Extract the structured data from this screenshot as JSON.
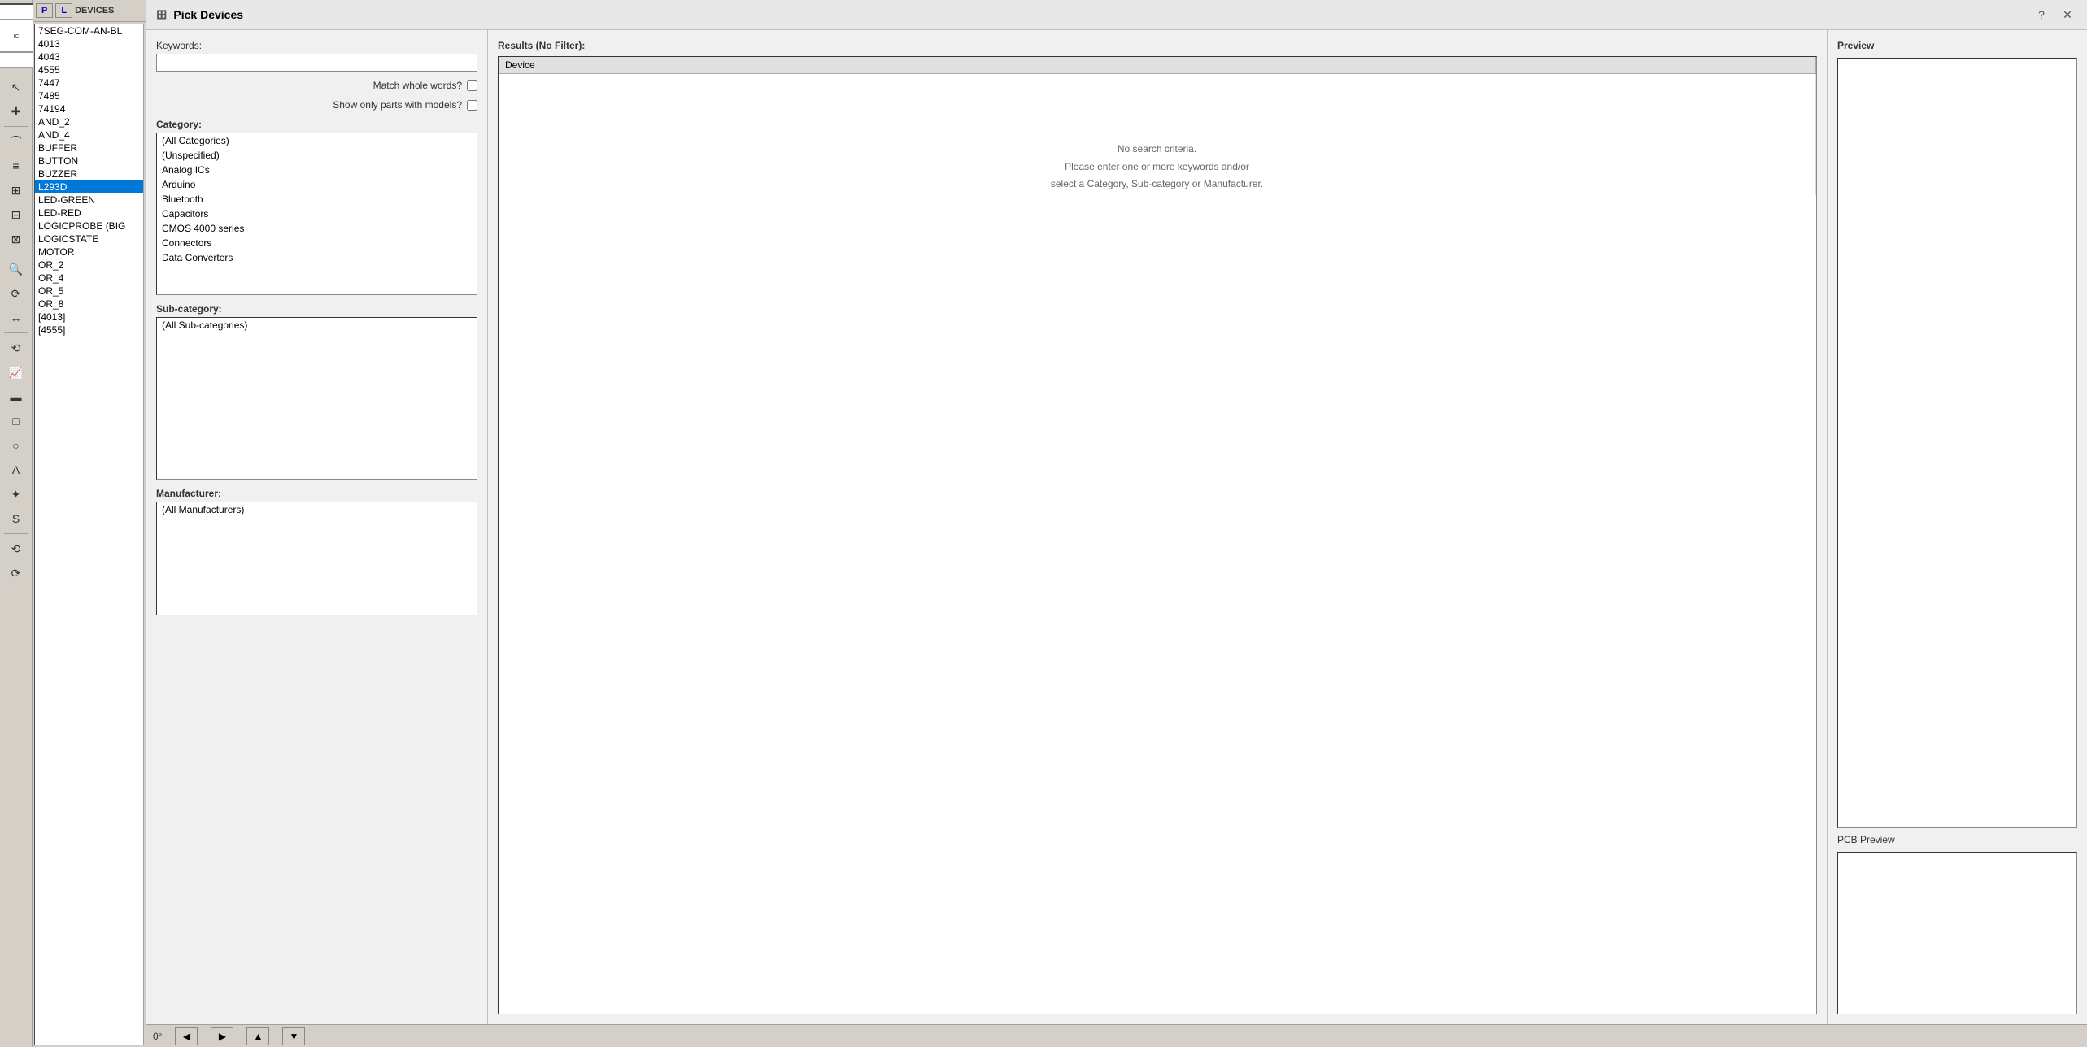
{
  "toolbar": {
    "buttons": [
      "↖",
      "✚",
      "≡",
      "⊞",
      "⊟",
      "⊠",
      "↔",
      "↕",
      "⤢",
      "⟲",
      "⟳",
      "▷",
      "▲",
      "◉",
      "◈",
      "⬡",
      "✏",
      "⌒",
      "▬",
      "✦",
      "S",
      "✚",
      "⟲",
      "⟳"
    ]
  },
  "component_panel": {
    "p_tab": "P",
    "l_tab": "L",
    "header": "DEVICES",
    "items": [
      {
        "label": "7SEG-COM-AN-BL",
        "selected": false
      },
      {
        "label": "4013",
        "selected": false
      },
      {
        "label": "4043",
        "selected": false
      },
      {
        "label": "4555",
        "selected": false
      },
      {
        "label": "7447",
        "selected": false
      },
      {
        "label": "7485",
        "selected": false
      },
      {
        "label": "74194",
        "selected": false
      },
      {
        "label": "AND_2",
        "selected": false
      },
      {
        "label": "AND_4",
        "selected": false
      },
      {
        "label": "BUFFER",
        "selected": false
      },
      {
        "label": "BUTTON",
        "selected": false
      },
      {
        "label": "BUZZER",
        "selected": false
      },
      {
        "label": "L293D",
        "selected": true
      },
      {
        "label": "LED-GREEN",
        "selected": false
      },
      {
        "label": "LED-RED",
        "selected": false
      },
      {
        "label": "LOGICPROBE (BIG",
        "selected": false
      },
      {
        "label": "LOGICSTATE",
        "selected": false
      },
      {
        "label": "MOTOR",
        "selected": false
      },
      {
        "label": "OR_2",
        "selected": false
      },
      {
        "label": "OR_4",
        "selected": false
      },
      {
        "label": "OR_5",
        "selected": false
      },
      {
        "label": "OR_8",
        "selected": false
      },
      {
        "label": "[4013]",
        "selected": false
      },
      {
        "label": "[4555]",
        "selected": false
      }
    ]
  },
  "dialog": {
    "title": "Pick Devices",
    "title_icon": "⊞",
    "help_label": "?",
    "close_label": "✕",
    "keywords_label": "Keywords:",
    "keywords_value": "",
    "match_whole_words_label": "Match whole words?",
    "match_whole_words_checked": false,
    "show_only_parts_label": "Show only parts with models?",
    "show_only_parts_checked": false,
    "category_label": "Category:",
    "categories": [
      {
        "label": "(All Categories)",
        "selected": false
      },
      {
        "label": "(Unspecified)",
        "selected": false
      },
      {
        "label": "Analog ICs",
        "selected": false
      },
      {
        "label": "Arduino",
        "selected": false
      },
      {
        "label": "Bluetooth",
        "selected": false
      },
      {
        "label": "Capacitors",
        "selected": false
      },
      {
        "label": "CMOS 4000 series",
        "selected": false
      },
      {
        "label": "Connectors",
        "selected": false
      },
      {
        "label": "Data Converters",
        "selected": false
      }
    ],
    "subcategory_label": "Sub-category:",
    "subcategories": [
      {
        "label": "(All Sub-categories)",
        "selected": false
      }
    ],
    "manufacturer_label": "Manufacturer:",
    "manufacturers": [
      {
        "label": "(All Manufacturers)",
        "selected": false
      }
    ],
    "results_label": "Results (No Filter):",
    "results_column": "Device",
    "no_results_line1": "No search criteria.",
    "no_results_line2": "Please enter one or more keywords and/or",
    "no_results_line3": "select a Category, Sub-category or Manufacturer.",
    "preview_label": "Preview",
    "pcb_preview_label": "PCB Preview"
  },
  "bottom_bar": {
    "angle": "0°",
    "left_arrow": "◀",
    "right_arrow": "▶",
    "up_arrow": "▲",
    "down_arrow": "▼"
  }
}
